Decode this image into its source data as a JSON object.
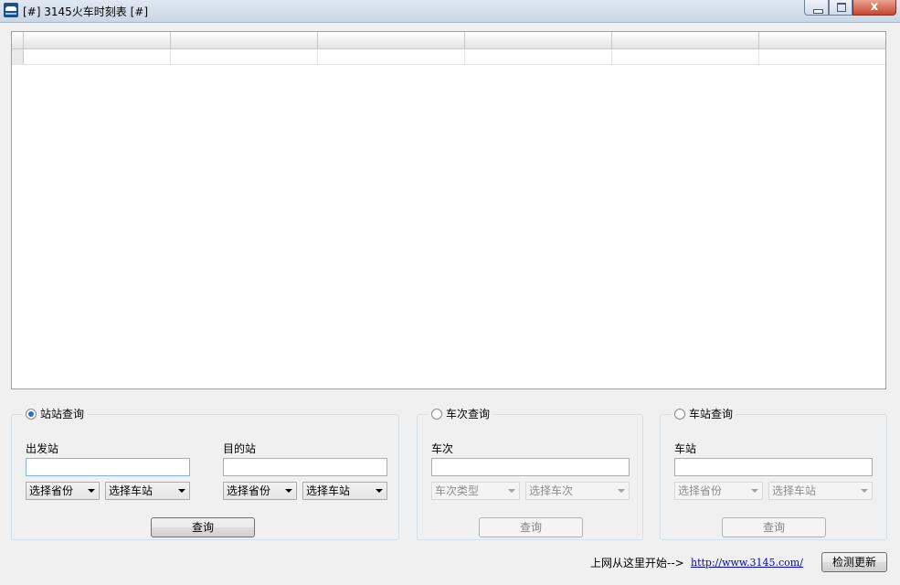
{
  "window": {
    "title": "[#] 3145火车时刻表 [#]",
    "close_label": "x"
  },
  "grid": {
    "columns": [
      "",
      "",
      "",
      "",
      "",
      ""
    ]
  },
  "station_query": {
    "radio_label": "站站查询",
    "selected": true,
    "from_label": "出发站",
    "from_value": "",
    "to_label": "目的站",
    "to_value": "",
    "from_province": "选择省份",
    "from_station": "选择车站",
    "to_province": "选择省份",
    "to_station": "选择车站",
    "query_button": "查询"
  },
  "train_query": {
    "radio_label": "车次查询",
    "selected": false,
    "train_label": "车次",
    "train_value": "",
    "train_type": "车次类型",
    "train_select": "选择车次",
    "query_button": "查询"
  },
  "stop_query": {
    "radio_label": "车站查询",
    "selected": false,
    "station_label": "车站",
    "station_value": "",
    "province": "选择省份",
    "station_select": "选择车站",
    "query_button": "查询"
  },
  "footer": {
    "start_text": "上网从这里开始-->",
    "link_text": "http://www.3145.com/",
    "update_button": "检测更新"
  }
}
